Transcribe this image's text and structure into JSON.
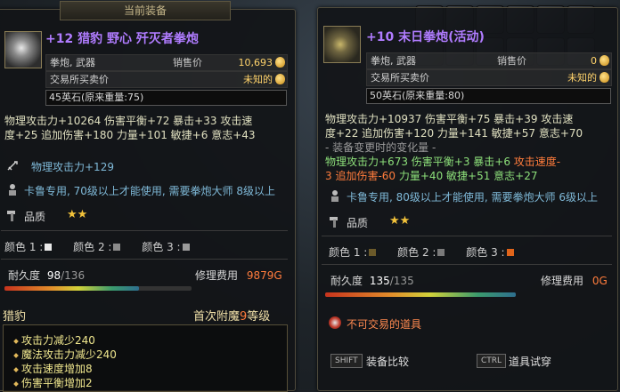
{
  "header_tab": "当前装备",
  "left": {
    "title": "+12 猎豹 野心 歼灭者拳炮",
    "type_label": "拳炮, 武器",
    "price_label": "销售价",
    "price_value": "10,693",
    "trade_label": "交易所买卖价",
    "trade_value": "未知的",
    "weight": "45英石(原来重量:75)",
    "stats_line1": "物理攻击力+10264 伤害平衡+72 暴击+33 攻击速",
    "stats_line2": "度+25 追加伤害+180 力量+101 敏捷+6 意志+43",
    "extra_stat": "物理攻击力+129",
    "req": "卡鲁专用, 70级以上才能使用, 需要拳炮大师 8级以上",
    "quality_label": "品质",
    "quality_stars": "★★",
    "color1_label": "颜色 1 :",
    "color2_label": "颜色 2 :",
    "color3_label": "颜色 3 :",
    "color1": "#e9e9e9",
    "color2": "#8a8a8a",
    "color3": "#9a9a9a",
    "durability_label": "耐久度",
    "durability_cur": "98",
    "durability_max": "/136",
    "durability_fraction": 0.72,
    "repair_label": "修理费用",
    "repair_value": "9879",
    "repair_unit": "G",
    "set_name": "猎豹",
    "enchant_prefix": "首次附魔",
    "enchant_level": "9",
    "enchant_suffix": "等级",
    "effects": [
      "攻击力减少240",
      "魔法攻击力减少240",
      "攻击速度增加8",
      "伤害平衡增加2"
    ]
  },
  "right": {
    "title": "+10 末日拳炮(活动)",
    "type_label": "拳炮, 武器",
    "price_label": "销售价",
    "price_value": "0",
    "trade_label": "交易所买卖价",
    "trade_value": "未知的",
    "weight": "50英石(原来重量:80)",
    "stats_line1": "物理攻击力+10937 伤害平衡+75 暴击+39 攻击速",
    "stats_line2": "度+22 追加伤害+120 力量+141 敏捷+57 意志+70",
    "change_header": "- 装备变更时的变化量 -",
    "change_line1_a": "物理攻击力+673 伤害平衡+3 暴击+6 ",
    "change_line1_b": "攻击速度-",
    "change_line2_a": "3 追加伤害-60 ",
    "change_line2_b": "力量+40 敏捷+51 意志+27",
    "req": "卡鲁专用, 80级以上才能使用, 需要拳炮大师 6级以上",
    "quality_label": "品质",
    "quality_stars": "★★",
    "color1_label": "颜色 1 :",
    "color2_label": "颜色 2 :",
    "color3_label": "颜色 3 :",
    "color1": "#6b5a2a",
    "color2": "#7a7a7a",
    "color3": "#e0641a",
    "durability_label": "耐久度",
    "durability_cur": "135",
    "durability_max": "/135",
    "durability_fraction": 1.0,
    "repair_label": "修理费用",
    "repair_value": "0",
    "repair_unit": "G",
    "untradeable": "不可交易的道具",
    "key_shift": "SHIFT",
    "compare_label": "装备比较",
    "key_ctrl": "CTRL",
    "tryon_label": "道具试穿"
  }
}
